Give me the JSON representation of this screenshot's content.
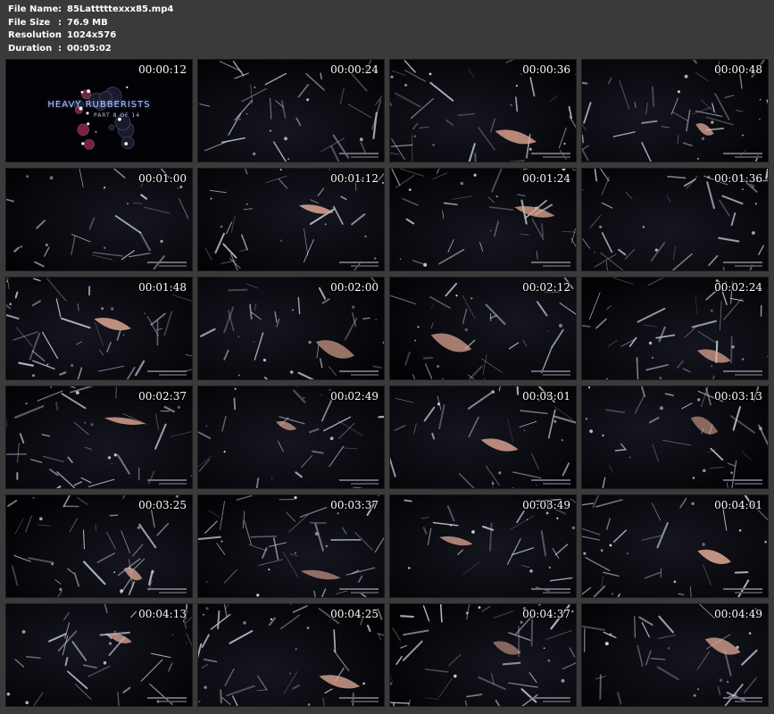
{
  "file_info": {
    "rows": [
      {
        "key": "File Name",
        "sep": ":",
        "value": "85Latttttexxx85.mp4"
      },
      {
        "key": "File Size",
        "sep": ":",
        "value": "76.9 MB"
      },
      {
        "key": "Resolution",
        "sep": ":",
        "value": "1024x576"
      },
      {
        "key": "Duration",
        "sep": ":",
        "value": "00:05:02"
      }
    ]
  },
  "thumbnails": [
    {
      "time": "00:00:12",
      "scene": "title-card"
    },
    {
      "time": "00:00:24",
      "scene": "dark-latex"
    },
    {
      "time": "00:00:36",
      "scene": "dark-latex"
    },
    {
      "time": "00:00:48",
      "scene": "dark-latex"
    },
    {
      "time": "00:01:00",
      "scene": "dark-latex"
    },
    {
      "time": "00:01:12",
      "scene": "dark-latex"
    },
    {
      "time": "00:01:24",
      "scene": "dark-latex"
    },
    {
      "time": "00:01:36",
      "scene": "dark-latex"
    },
    {
      "time": "00:01:48",
      "scene": "dark-latex"
    },
    {
      "time": "00:02:00",
      "scene": "dark-latex"
    },
    {
      "time": "00:02:12",
      "scene": "dark-latex"
    },
    {
      "time": "00:02:24",
      "scene": "dark-latex"
    },
    {
      "time": "00:02:37",
      "scene": "dark-latex"
    },
    {
      "time": "00:02:49",
      "scene": "dark-latex"
    },
    {
      "time": "00:03:01",
      "scene": "dark-latex"
    },
    {
      "time": "00:03:13",
      "scene": "dark-latex"
    },
    {
      "time": "00:03:25",
      "scene": "dark-latex"
    },
    {
      "time": "00:03:37",
      "scene": "dark-latex"
    },
    {
      "time": "00:03:49",
      "scene": "dark-latex"
    },
    {
      "time": "00:04:01",
      "scene": "dark-latex"
    },
    {
      "time": "00:04:13",
      "scene": "dark-latex"
    },
    {
      "time": "00:04:25",
      "scene": "dark-latex"
    },
    {
      "time": "00:04:37",
      "scene": "dark-latex"
    },
    {
      "time": "00:04:49",
      "scene": "dark-latex"
    }
  ],
  "title_card": {
    "line1": "HEAVY RUBBERISTS",
    "line2": "PART 8 OF 14"
  },
  "colors": {
    "background": "#3a3a3a",
    "frame": "#05050a",
    "highlight": "#c8ccd8",
    "skin": "#e0a894",
    "title_text": "#b8c4e8"
  }
}
